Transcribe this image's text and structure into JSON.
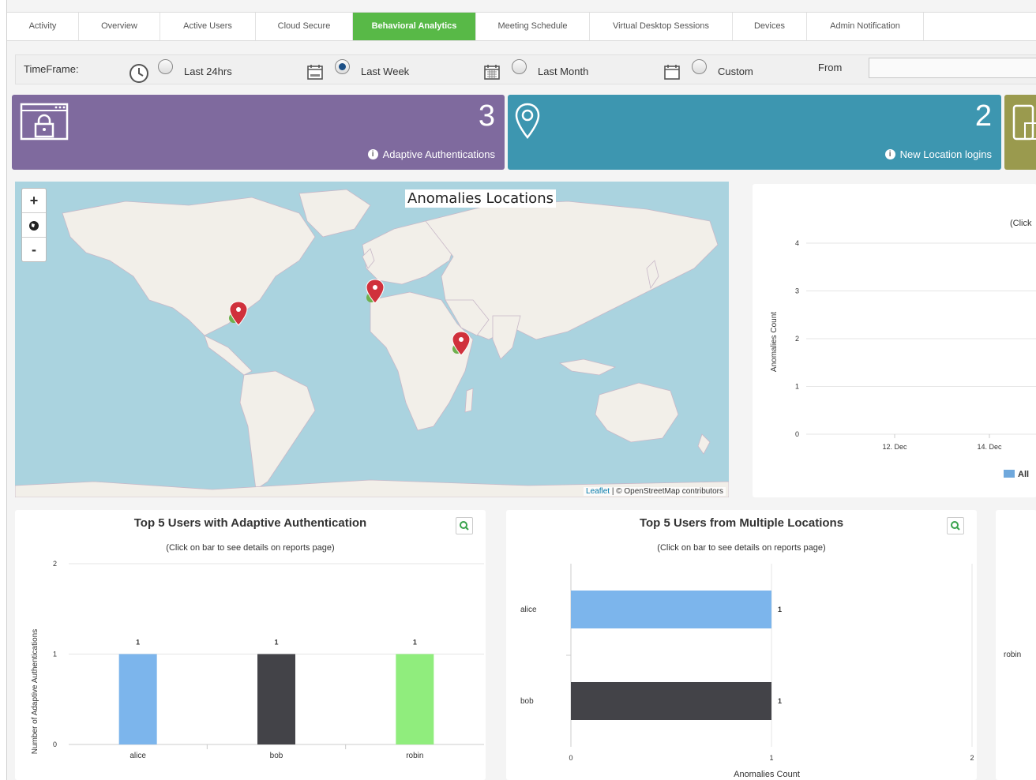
{
  "tabs": [
    "Activity",
    "Overview",
    "Active Users",
    "Cloud Secure",
    "Behavioral Analytics",
    "Meeting Schedule",
    "Virtual Desktop Sessions",
    "Devices",
    "Admin Notification"
  ],
  "active_tab": "Behavioral Analytics",
  "timeframe": {
    "label": "TimeFrame:",
    "options": [
      "Last 24hrs",
      "Last Week",
      "Last Month",
      "Custom"
    ],
    "selected": "Last Week",
    "from_label": "From",
    "from_value": ""
  },
  "cards": {
    "adaptive": {
      "value": "3",
      "label": "Adaptive Authentications",
      "color": "#7f6a9e"
    },
    "location": {
      "value": "2",
      "label": "New Location logins",
      "color": "#3d96b0"
    },
    "third_color": "#9a9a4e"
  },
  "map": {
    "title": "Anomalies Locations",
    "attribution_link": "Leaflet",
    "attribution_text": "| © OpenStreetMap contributors",
    "zoom_in": "+",
    "zoom_out": "-"
  },
  "line_chart": {
    "subtitle_partial": "(Click",
    "ylabel": "Anomalies Count",
    "y_ticks": [
      "0",
      "1",
      "2",
      "3",
      "4"
    ],
    "x_ticks": [
      "12. Dec",
      "14. Dec"
    ],
    "legend": "All",
    "legend_color": "#6fa8dc"
  },
  "chart_data": [
    {
      "type": "bar",
      "title": "Top 5 Users with Adaptive Authentication",
      "subtitle": "(Click on bar to see details on reports page)",
      "ylabel": "Number of Adaptive Authentications",
      "categories": [
        "alice",
        "bob",
        "robin"
      ],
      "values": [
        1,
        1,
        1
      ],
      "colors": [
        "#7cb5ec",
        "#434348",
        "#90ed7d"
      ],
      "ylim": [
        0,
        2
      ],
      "y_ticks": [
        "0",
        "1",
        "2"
      ]
    },
    {
      "type": "bar",
      "orientation": "horizontal",
      "title": "Top 5 Users from Multiple Locations",
      "subtitle": "(Click on bar to see details on reports page)",
      "xlabel": "Anomalies Count",
      "categories": [
        "alice",
        "bob"
      ],
      "values": [
        1,
        1
      ],
      "colors": [
        "#7cb5ec",
        "#434348"
      ],
      "xlim": [
        0,
        2
      ],
      "x_ticks": [
        "0",
        "1",
        "2"
      ]
    }
  ],
  "partial_panel": {
    "category": "robin"
  }
}
